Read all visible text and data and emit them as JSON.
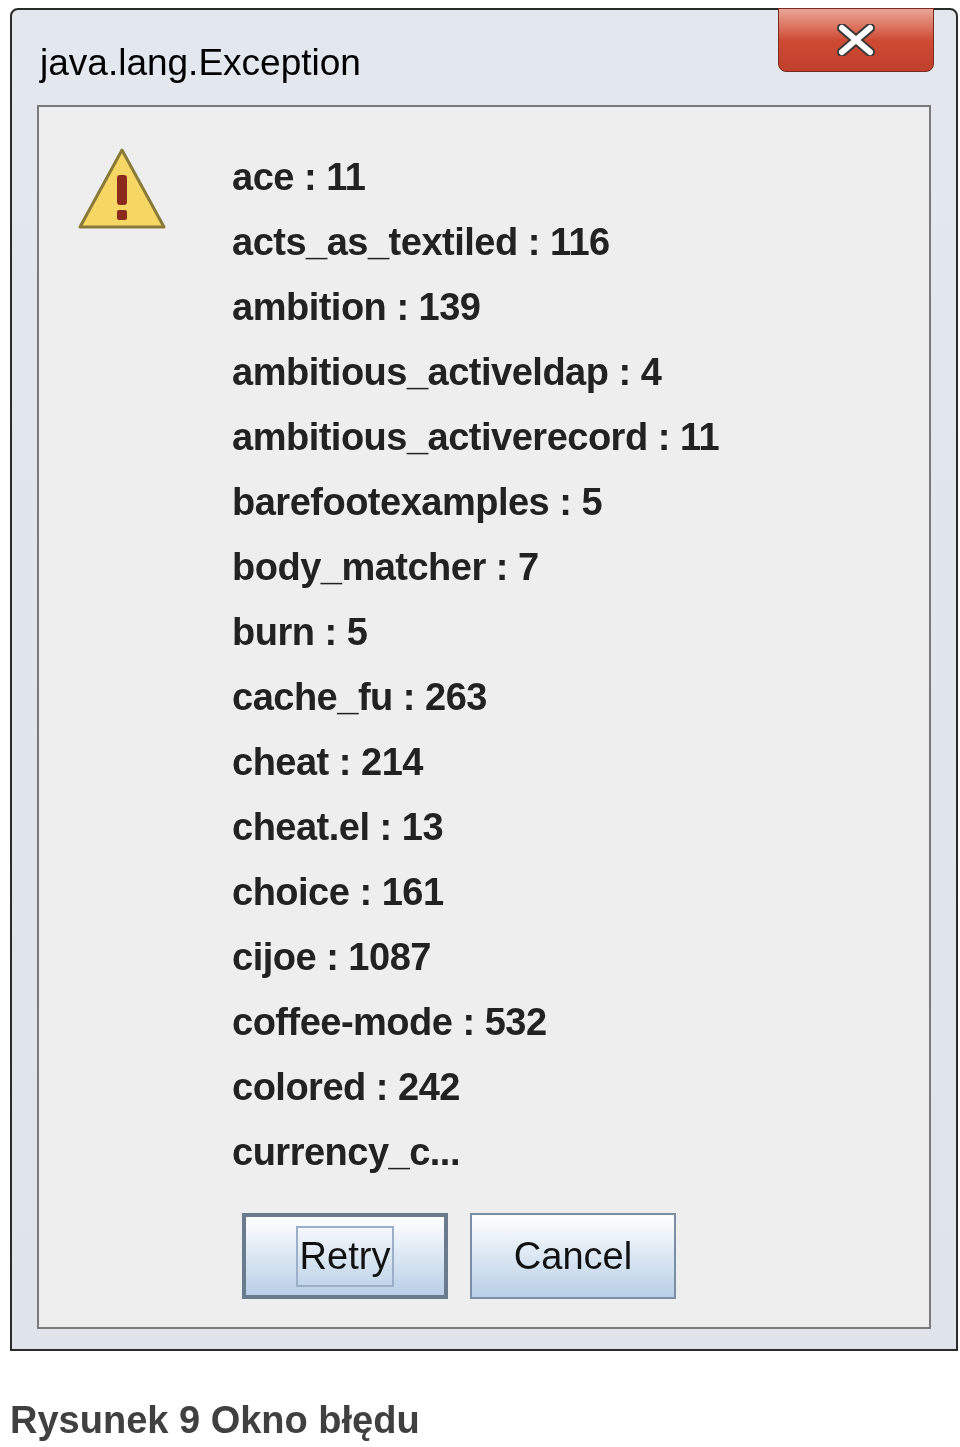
{
  "window": {
    "title": "java.lang.Exception"
  },
  "message_lines": [
    "ace : 11",
    "acts_as_textiled : 116",
    "ambition : 139",
    "ambitious_activeldap : 4",
    "ambitious_activerecord : 11",
    "barefootexamples : 5",
    "body_matcher : 7",
    "burn : 5",
    "cache_fu : 263",
    "cheat : 214",
    "cheat.el : 13",
    "choice : 161",
    "cijoe : 1087",
    "coffee-mode : 532",
    "colored : 242",
    "currency_c..."
  ],
  "buttons": [
    {
      "label": "Retry",
      "focused": true
    },
    {
      "label": "Cancel",
      "focused": false
    }
  ],
  "caption": "Rysunek 9 Okno błędu"
}
